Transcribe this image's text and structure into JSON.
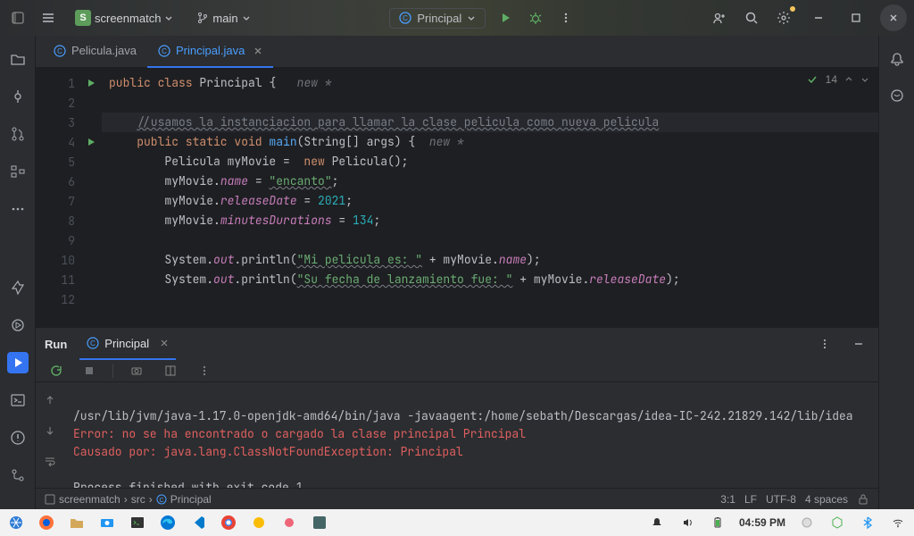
{
  "titlebar": {
    "project": "screenmatch",
    "branch": "main",
    "run_config": "Principal"
  },
  "tabs": [
    {
      "name": "Pelicula.java",
      "active": false
    },
    {
      "name": "Principal.java",
      "active": true
    }
  ],
  "inspection": {
    "count": "14"
  },
  "gutter_lines": [
    "1",
    "2",
    "3",
    "4",
    "5",
    "6",
    "7",
    "8",
    "9",
    "10",
    "11",
    "12"
  ],
  "code": {
    "l1": {
      "kw1": "public ",
      "kw2": "class ",
      "cls": "Principal ",
      "brace": "{",
      "hint": "   new *"
    },
    "l3": {
      "com": "//usamos la instanciacion para llamar la clase pelicula como nueva pelicula"
    },
    "l4": {
      "a": "public static ",
      "b": "void ",
      "fn": "main",
      "c": "(String[] args) {",
      "hint": "  new *"
    },
    "l5": {
      "a": "Pelicula myMovie =  ",
      "kw": "new ",
      "b": "Pelicula();"
    },
    "l6": {
      "a": "myMovie.",
      "f": "name",
      "b": " = ",
      "s": "\"encanto\"",
      "c": ";"
    },
    "l7": {
      "a": "myMovie.",
      "f": "releaseDate",
      "b": " = ",
      "n": "2021",
      "c": ";"
    },
    "l8": {
      "a": "myMovie.",
      "f": "minutesDurations",
      "b": " = ",
      "n": "134",
      "c": ";"
    },
    "l10": {
      "a": "System.",
      "f": "out",
      "b": ".println(",
      "s": "\"Mi pelicula es: \"",
      "c": " + myMovie.",
      "f2": "name",
      "d": ");"
    },
    "l11": {
      "a": "System.",
      "f": "out",
      "b": ".println(",
      "s": "\"Su fecha de lanzamiento fue: \"",
      "c": " + myMovie.",
      "f2": "releaseDate",
      "d": ");"
    }
  },
  "run": {
    "title": "Run",
    "tab": "Principal",
    "out_cmd": "/usr/lib/jvm/java-1.17.0-openjdk-amd64/bin/java -javaagent:/home/sebath/Descargas/idea-IC-242.21829.142/lib/idea",
    "out_err1": "Error: no se ha encontrado o cargado la clase principal Principal",
    "out_err2": "Causado por: java.lang.ClassNotFoundException: Principal",
    "out_exit": "Process finished with exit code 1"
  },
  "status": {
    "crumb1": "screenmatch",
    "crumb2": "src",
    "crumb3": "Principal",
    "pos": "3:1",
    "lf": "LF",
    "enc": "UTF-8",
    "indent": "4 spaces"
  },
  "taskbar": {
    "clock": "04:59 PM"
  }
}
